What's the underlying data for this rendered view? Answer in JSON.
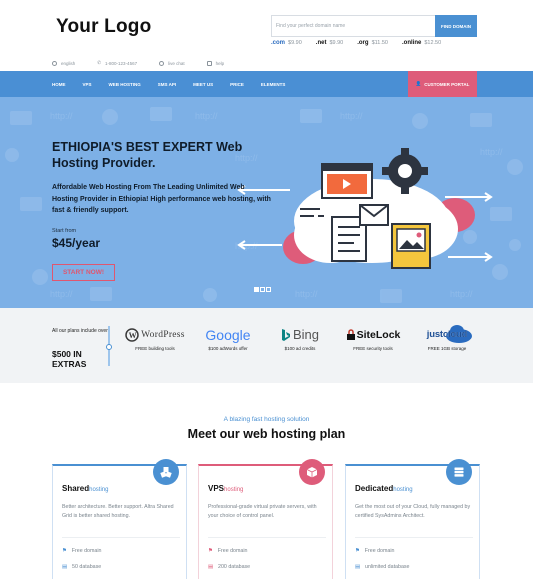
{
  "header": {
    "logo": "Your Logo",
    "search": {
      "placeholder": "Find your perfect domain name",
      "button": "FIND DOMAIN"
    },
    "tlds": [
      {
        "ext": ".com",
        "price": "$9.90",
        "color": "#2a6bbf"
      },
      {
        "ext": ".net",
        "price": "$9.90",
        "color": "#111111"
      },
      {
        "ext": ".org",
        "price": "$11.50",
        "color": "#e08a1e"
      },
      {
        "ext": ".online",
        "price": "$12.50",
        "color": "#2f9e5a"
      }
    ],
    "topinfo": [
      "english",
      "1-800-123-4567",
      "live chat",
      "help"
    ]
  },
  "nav": {
    "items": [
      "HOME",
      "VPS",
      "WEB HOSTING",
      "SMS API",
      "MEET US",
      "PRICE",
      "ELEMENTS"
    ],
    "portal": "CUSTOMER PORTAL",
    "portal_color": "#de5c7a",
    "bar_color": "#4a8fd4"
  },
  "hero": {
    "title": "ETHIOPIA'S BEST EXPERT Web Hosting Provider.",
    "description": "Affordable Web Hosting From The Leading Unlimited Web Hosting Provider in Ethiopia! High performance web hosting, with fast & friendly support.",
    "start_label": "Start from",
    "price": "$45/year",
    "cta": "START NOW!",
    "slides": 3,
    "active_slide": 1,
    "pattern_text": "http://"
  },
  "partners": {
    "intro_small": "All our plans include over",
    "intro_big": "$500 IN EXTRAS",
    "items": [
      {
        "name": "WordPress",
        "icon": "wordpress-icon",
        "caption": "FREE building tools"
      },
      {
        "name": "Google",
        "icon": "google-logo",
        "caption": "$100 adWords offer"
      },
      {
        "name": "Bing",
        "icon": "bing-icon",
        "caption": "$100 ad credits"
      },
      {
        "name": "SiteLock",
        "icon": "sitelock-icon",
        "caption": "FREE security tools"
      },
      {
        "name": "justcloud",
        "icon": "justcloud-icon",
        "caption": "FREE 1GB storage"
      }
    ]
  },
  "plans_section": {
    "kicker": "A blazing fast hosting solution",
    "title": "Meet our web hosting plan",
    "plans": [
      {
        "name": "Shared",
        "suffix": "hosting",
        "color": "#4a90d2",
        "icon": "cubes-icon",
        "desc": "Better architecture. Better support. Altra Shared Grid is better shared hosting.",
        "features": [
          "Free domain",
          "50 database"
        ]
      },
      {
        "name": "VPS",
        "suffix": "hosting",
        "color": "#de5c7a",
        "icon": "box-icon",
        "desc": "Professional-grade virtual private servers, with your choice of control panel.",
        "features": [
          "Free domain",
          "200 database"
        ]
      },
      {
        "name": "Dedicated",
        "suffix": "hosting",
        "color": "#4a90d2",
        "icon": "server-icon",
        "desc": "Get the most out of your Cloud, fully managed by certified SysAdmins Architect.",
        "features": [
          "Free domain",
          "unlimited database"
        ]
      }
    ]
  }
}
